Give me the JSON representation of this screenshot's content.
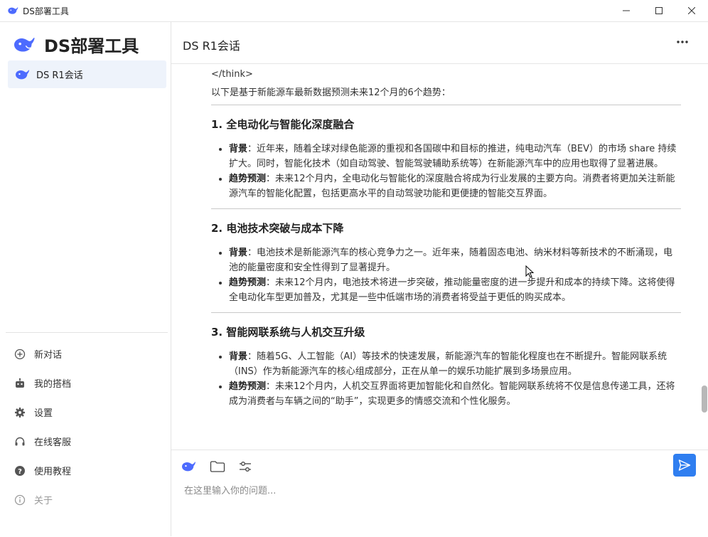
{
  "window": {
    "title": "DS部署工具"
  },
  "sidebar": {
    "brand_title": "DS部署工具",
    "sessions": [
      {
        "label": "DS R1会话"
      }
    ],
    "menu": [
      {
        "label": "新对话",
        "icon": "plus-circle-icon"
      },
      {
        "label": "我的搭档",
        "icon": "robot-icon"
      },
      {
        "label": "设置",
        "icon": "gear-icon"
      },
      {
        "label": "在线客服",
        "icon": "headset-icon"
      },
      {
        "label": "使用教程",
        "icon": "help-circle-icon"
      },
      {
        "label": "关于",
        "icon": "info-circle-icon"
      }
    ]
  },
  "header": {
    "title": "DS R1会话"
  },
  "message": {
    "think_close": "</think>",
    "intro": "以下是基于新能源车最新数据预测未来12个月的6个趋势：",
    "sections": [
      {
        "title": "1. 全电动化与智能化深度融合",
        "items": [
          {
            "label": "背景",
            "text": "：近年来，随着全球对绿色能源的重视和各国碳中和目标的推进，纯电动汽车（BEV）的市场 share 持续扩大。同时，智能化技术（如自动驾驶、智能驾驶辅助系统等）在新能源汽车中的应用也取得了显著进展。"
          },
          {
            "label": "趋势预测",
            "text": "：未来12个月内，全电动化与智能化的深度融合将成为行业发展的主要方向。消费者将更加关注新能源汽车的智能化配置，包括更高水平的自动驾驶功能和更便捷的智能交互界面。"
          }
        ]
      },
      {
        "title": "2. 电池技术突破与成本下降",
        "items": [
          {
            "label": "背景",
            "text": "：电池技术是新能源汽车的核心竞争力之一。近年来，随着固态电池、纳米材料等新技术的不断涌现，电池的能量密度和安全性得到了显著提升。"
          },
          {
            "label": "趋势预测",
            "text": "：未来12个月内，电池技术将进一步突破，推动能量密度的进一步提升和成本的持续下降。这将使得全电动化车型更加普及，尤其是一些中低端市场的消费者将受益于更低的购买成本。"
          }
        ]
      },
      {
        "title": "3. 智能网联系统与人机交互升级",
        "items": [
          {
            "label": "背景",
            "text": "：随着5G、人工智能（AI）等技术的快速发展，新能源汽车的智能化程度也在不断提升。智能网联系统（INS）作为新能源汽车的核心组成部分，正在从单一的娱乐功能扩展到多场景应用。"
          },
          {
            "label": "趋势预测",
            "text": "：未来12个月内，人机交互界面将更加智能化和自然化。智能网联系统将不仅是信息传递工具，还将成为消费者与车辆之间的“助手”，实现更多的情感交流和个性化服务。"
          }
        ]
      }
    ]
  },
  "composer": {
    "placeholder": "在这里输入你的问题...",
    "value": "",
    "tools": [
      "whale-logo-icon",
      "folder-icon",
      "sliders-icon"
    ],
    "send_icon": "send-icon"
  },
  "colors": {
    "accent": "#2f7ef0",
    "brand": "#4d6bfe",
    "selected_bg": "#eef3fb"
  }
}
